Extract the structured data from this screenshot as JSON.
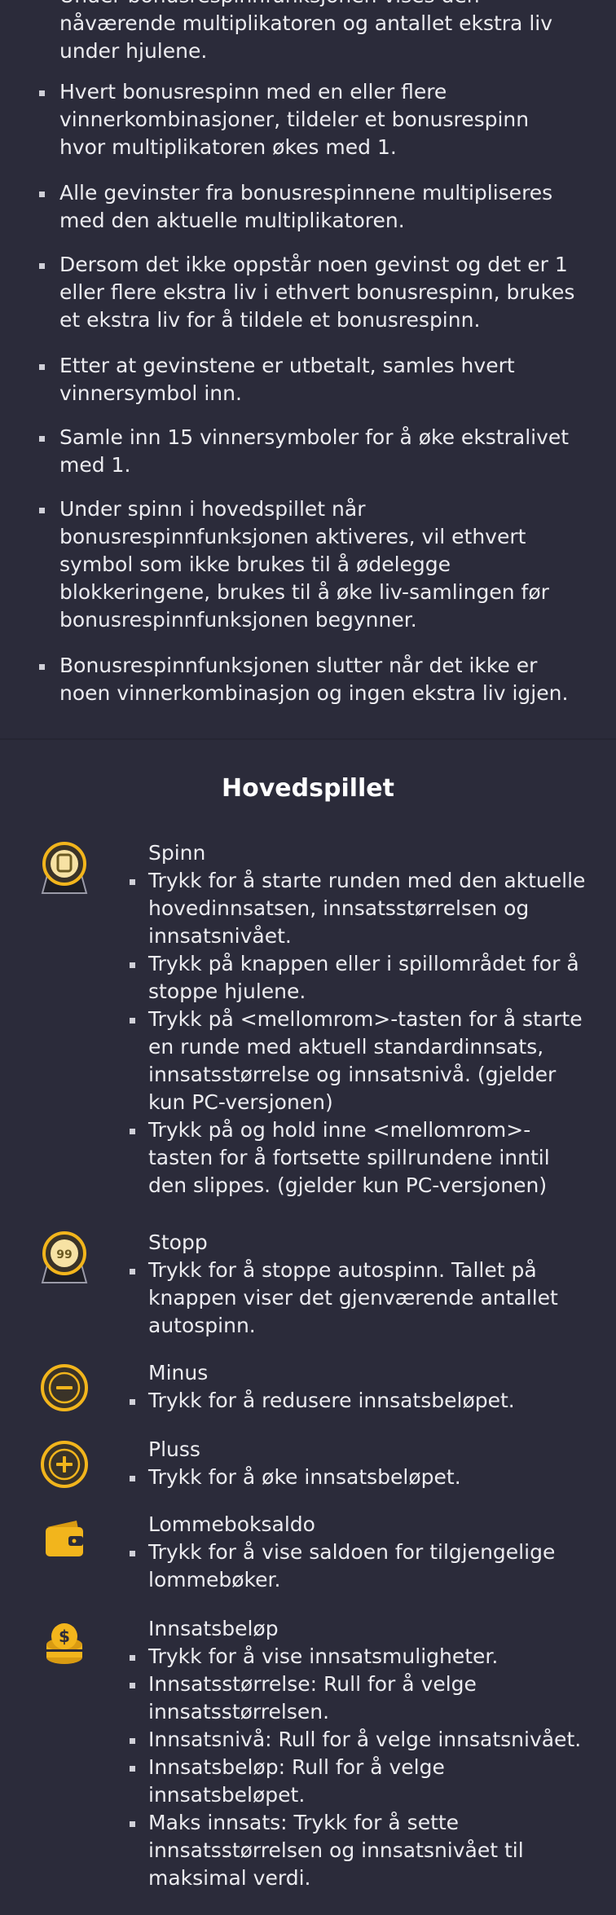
{
  "rules": {
    "bullets": [
      "Under bonusrespinnfunksjonen vises den nåværende multiplikatoren og antallet ekstra liv under hjulene.",
      "Hvert bonusrespinn med en eller flere vinnerkombinasjoner, tildeler et bonusrespinn hvor multiplikatoren økes med 1.",
      "Alle gevinster fra bonusrespinnene multipliseres med den aktuelle multiplikatoren.",
      "Dersom det ikke oppstår noen gevinst og det er 1 eller flere ekstra liv i ethvert bonusrespinn, brukes et ekstra liv for å tildele et bonusrespinn.",
      "Etter at gevinstene er utbetalt, samles hvert vinnersymbol inn.",
      "Samle inn 15 vinnersymboler for å øke ekstralivet med 1.",
      "Under spinn i hovedspillet når bonusrespinnfunksjonen aktiveres, vil ethvert symbol som ikke brukes til å ødelegge blokkeringene, brukes til å øke liv-samlingen før bonusrespinnfunksjonen begynner.",
      "Bonusrespinnfunksjonen slutter når det ikke er noen vinnerkombinasjon og ingen ekstra liv igjen."
    ]
  },
  "main_game": {
    "title": "Hovedspillet",
    "spin": {
      "name": "Spinn",
      "items": [
        "Trykk for å starte runden med den aktuelle hovedinnsatsen, innsatsstørrelsen og innsatsnivået.",
        "Trykk på knappen eller i spillområdet for å stoppe hjulene.",
        "Trykk på <mellomrom>-tasten for å starte en runde med aktuell standardinnsats, innsatsstørrelse og innsatsnivå. (gjelder kun PC-versjonen)",
        "Trykk på og hold inne <mellomrom>-tasten for å fortsette spillrundene inntil den slippes. (gjelder kun PC-versjonen)"
      ]
    },
    "stop": {
      "name": "Stopp",
      "badge": "99",
      "items": [
        "Trykk for å stoppe autospinn. Tallet på knappen viser det gjenværende antallet autospinn."
      ]
    },
    "minus": {
      "name": "Minus",
      "items": [
        "Trykk for å redusere innsatsbeløpet."
      ]
    },
    "plus": {
      "name": "Pluss",
      "items": [
        "Trykk for å øke innsatsbeløpet."
      ]
    },
    "wallet": {
      "name": "Lommeboksaldo",
      "items": [
        "Trykk for å vise saldoen for tilgjengelige lommebøker."
      ]
    },
    "bet": {
      "name": "Innsatsbeløp",
      "items": [
        "Trykk for å vise innsatsmuligheter.",
        "Innsatsstørrelse: Rull for å velge innsatsstørrelsen.",
        "Innsatsnivå: Rull for å velge innsatsnivået.",
        "Innsatsbeløp: Rull for å velge innsatsbeløpet.",
        "Maks innsats: Trykk for å sette innsatsstørrelsen og innsatsnivået til maksimal verdi."
      ]
    }
  },
  "colors": {
    "background": "#2b2b3a",
    "text": "#ececf0",
    "gold": "#f2b51c",
    "icon_dark": "#3a3328"
  }
}
